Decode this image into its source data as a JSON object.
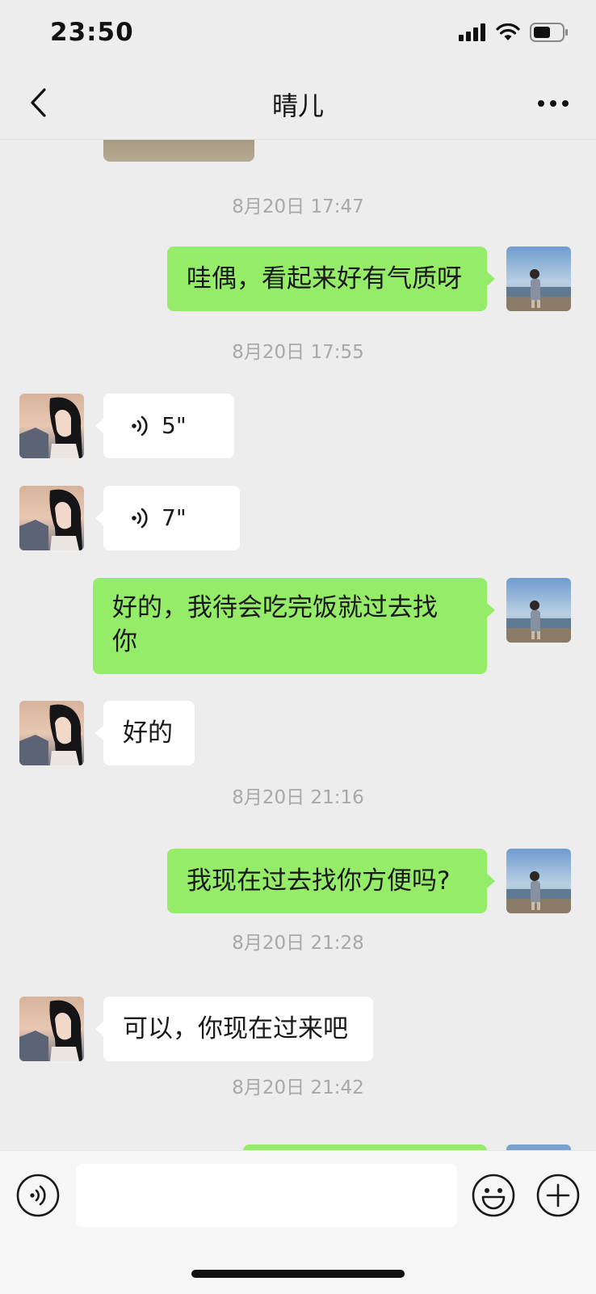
{
  "status": {
    "time": "23:50"
  },
  "header": {
    "title": "晴儿"
  },
  "messages": {
    "ts1": "8月20日 17:47",
    "m1": "哇偶，看起来好有气质呀",
    "ts2": "8月20日 17:55",
    "v1": "5\"",
    "v2": "7\"",
    "m2_line1": "好的，我待会吃完饭就过去找",
    "m2_line2": "你",
    "m3": "好的",
    "ts3": "8月20日 21:16",
    "m4": "我现在过去找你方便吗?",
    "ts4": "8月20日 21:28",
    "m5": "可以，你现在过来吧",
    "ts5": "8月20日 21:42"
  },
  "input": {
    "value": ""
  },
  "icons": {
    "back": "chevron-left-icon",
    "more": "more-dots-icon",
    "voice_msg": "voice-wave-icon",
    "voice_input": "voice-input-icon",
    "emoji": "emoji-icon",
    "plus": "plus-icon",
    "signal": "signal-icon",
    "wifi": "wifi-icon",
    "battery": "battery-icon"
  },
  "colors": {
    "outgoing_bubble": "#95ec69",
    "incoming_bubble": "#ffffff",
    "background": "#ededed"
  }
}
